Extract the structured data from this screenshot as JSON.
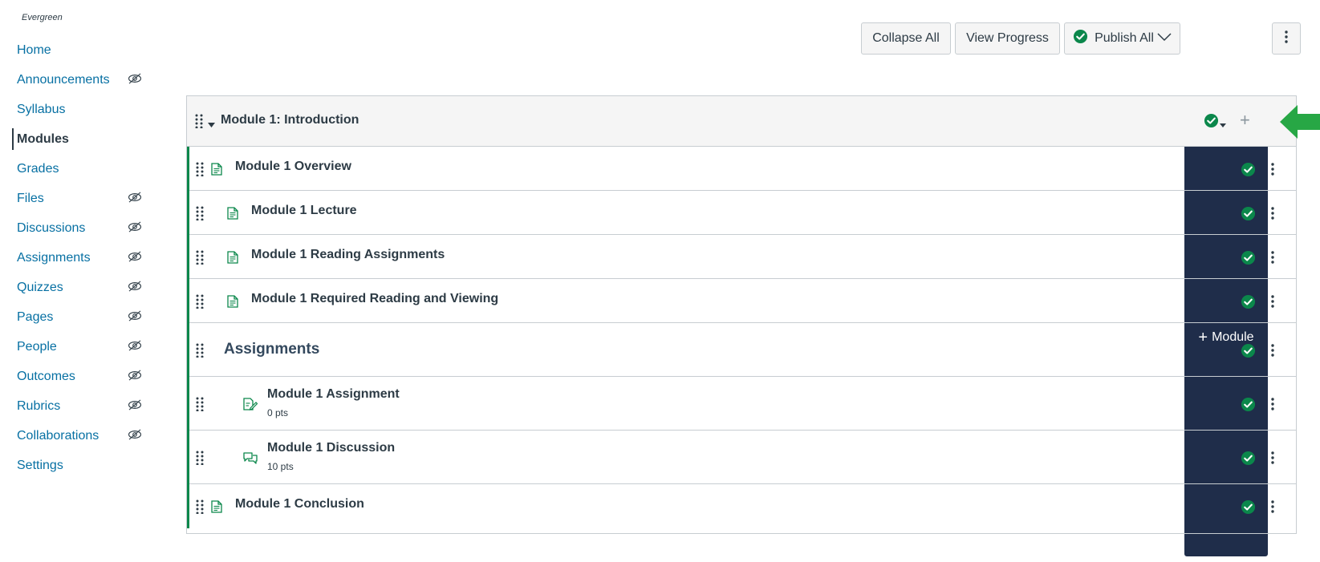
{
  "course": {
    "label": "Evergreen"
  },
  "nav": {
    "items": [
      {
        "label": "Home",
        "hidden": false,
        "active": false
      },
      {
        "label": "Announcements",
        "hidden": true,
        "active": false
      },
      {
        "label": "Syllabus",
        "hidden": false,
        "active": false
      },
      {
        "label": "Modules",
        "hidden": false,
        "active": true
      },
      {
        "label": "Grades",
        "hidden": false,
        "active": false
      },
      {
        "label": "Files",
        "hidden": true,
        "active": false
      },
      {
        "label": "Discussions",
        "hidden": true,
        "active": false
      },
      {
        "label": "Assignments",
        "hidden": true,
        "active": false
      },
      {
        "label": "Quizzes",
        "hidden": true,
        "active": false
      },
      {
        "label": "Pages",
        "hidden": true,
        "active": false
      },
      {
        "label": "People",
        "hidden": true,
        "active": false
      },
      {
        "label": "Outcomes",
        "hidden": true,
        "active": false
      },
      {
        "label": "Rubrics",
        "hidden": true,
        "active": false
      },
      {
        "label": "Collaborations",
        "hidden": true,
        "active": false
      },
      {
        "label": "Settings",
        "hidden": false,
        "active": false
      }
    ]
  },
  "toolbar": {
    "collapse_all": "Collapse All",
    "view_progress": "View Progress",
    "publish_all": "Publish All",
    "add_module": "Module"
  },
  "module": {
    "title": "Module 1: Introduction",
    "published": true,
    "items": [
      {
        "name": "Module 1 Overview",
        "type": "page",
        "indent": 0,
        "points": "",
        "published": true
      },
      {
        "name": "Module 1 Lecture",
        "type": "page",
        "indent": 1,
        "points": "",
        "published": true
      },
      {
        "name": "Module 1 Reading Assignments",
        "type": "page",
        "indent": 1,
        "points": "",
        "published": true
      },
      {
        "name": "Module 1 Required Reading and Viewing",
        "type": "page",
        "indent": 1,
        "points": "",
        "published": true
      },
      {
        "name": "Assignments",
        "type": "subheader",
        "indent": 0,
        "points": "",
        "published": true
      },
      {
        "name": "Module 1 Assignment",
        "type": "assignment",
        "indent": 2,
        "points": "0 pts",
        "published": true
      },
      {
        "name": "Module 1 Discussion",
        "type": "discussion",
        "indent": 2,
        "points": "10 pts",
        "published": true
      },
      {
        "name": "Module 1 Conclusion",
        "type": "page",
        "indent": 0,
        "points": "",
        "published": true
      }
    ]
  },
  "colors": {
    "link": "#0770a3",
    "published_green": "#0b874b",
    "primary_button": "#1f2d4a",
    "annotation_arrow": "#27a745"
  }
}
